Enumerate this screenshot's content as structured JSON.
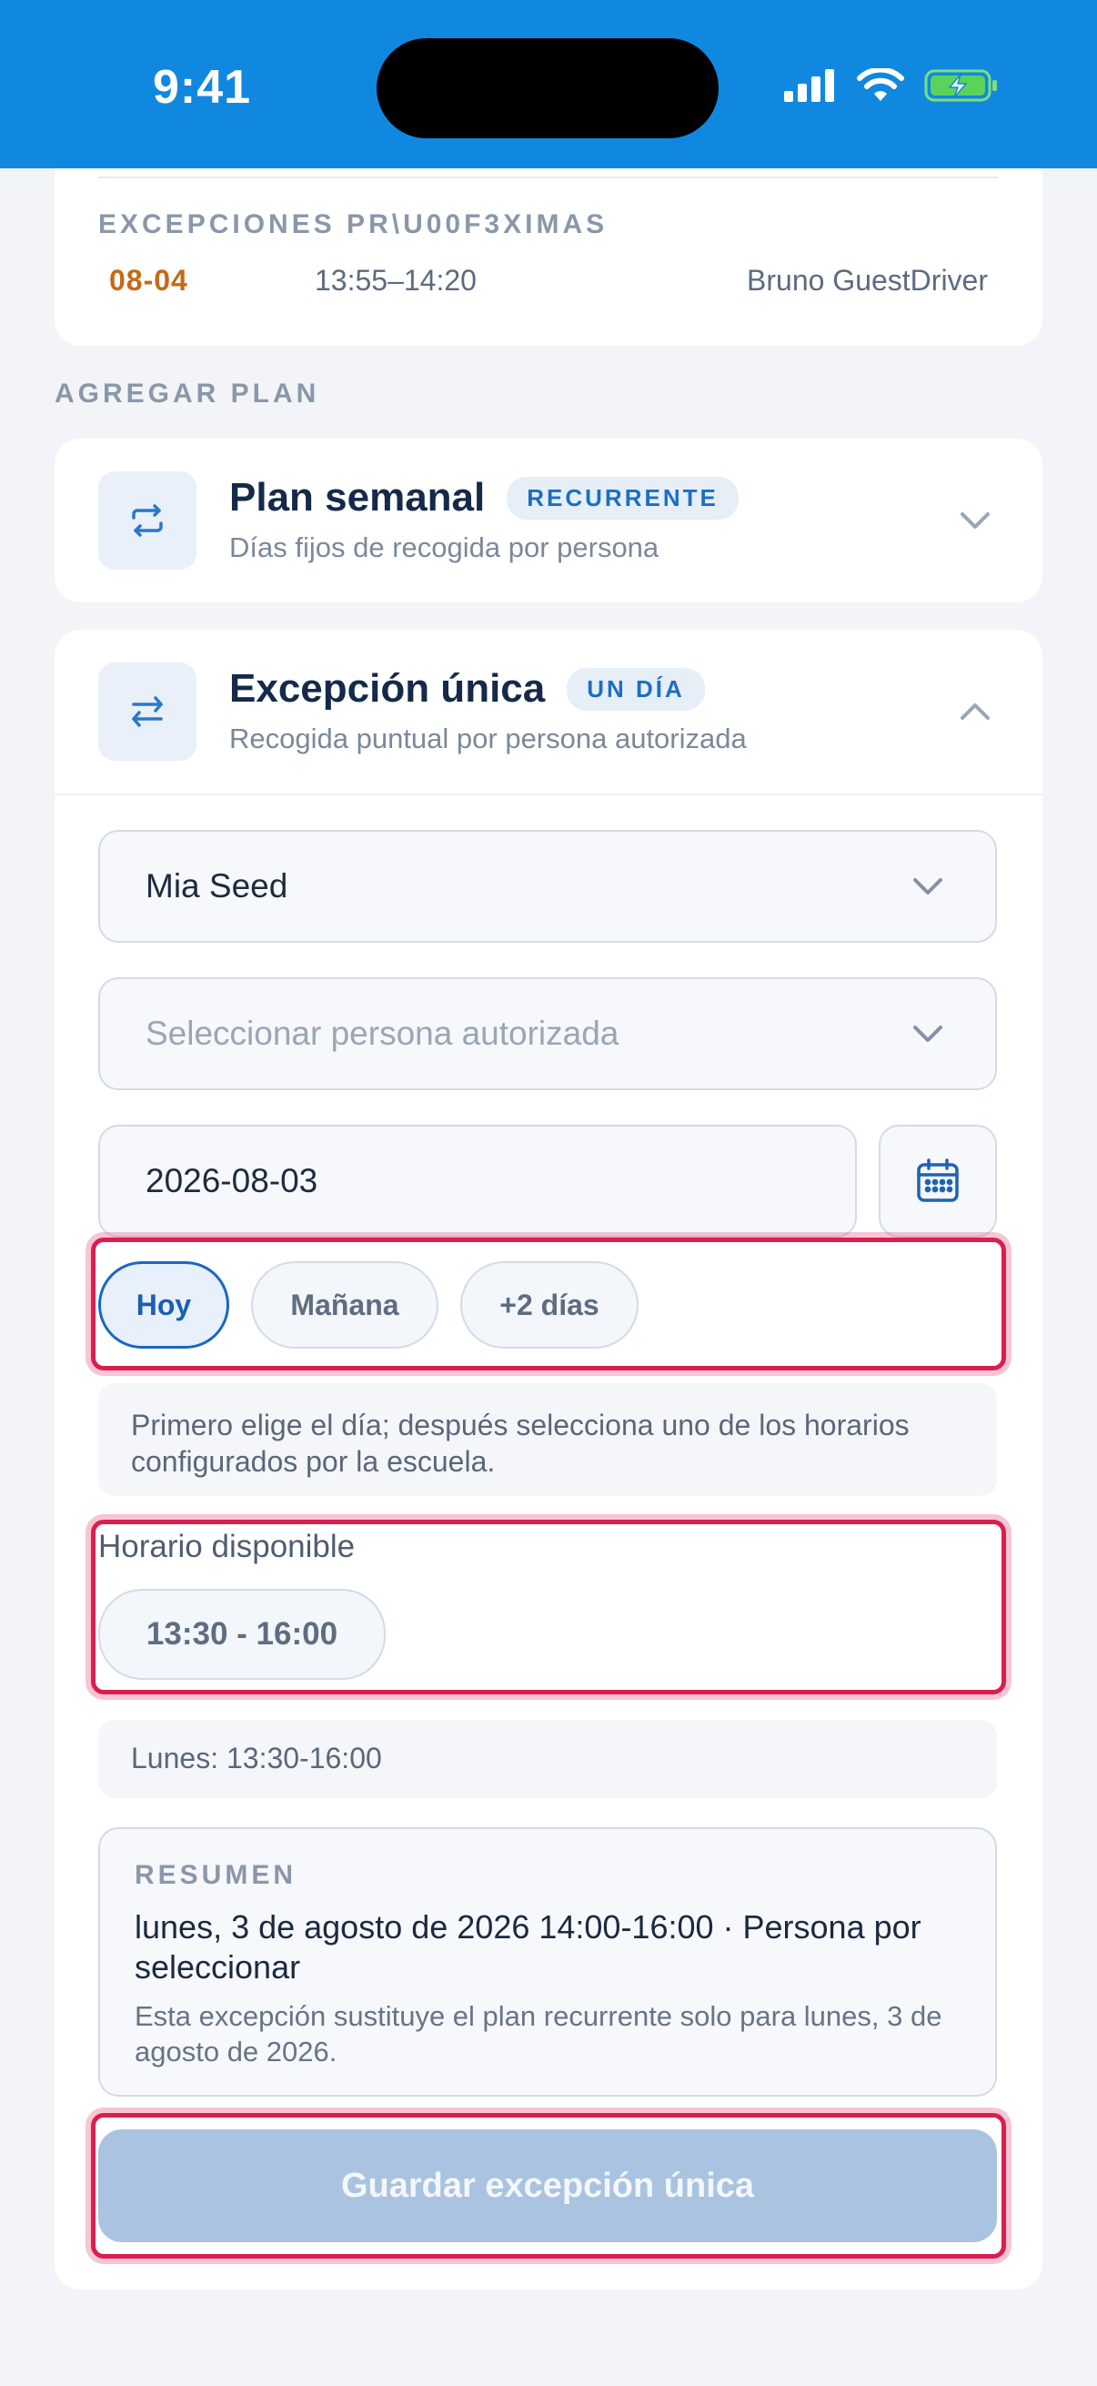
{
  "status_bar": {
    "time": "9:41"
  },
  "upcoming_exceptions": {
    "title": "EXCEPCIONES PR\\U00F3XIMAS",
    "items": [
      {
        "date": "08-04",
        "time": "13:55–14:20",
        "person": "Bruno GuestDriver"
      }
    ]
  },
  "add_plan": {
    "label": "AGREGAR PLAN",
    "weekly": {
      "title": "Plan semanal",
      "badge": "RECURRENTE",
      "subtitle": "Días fijos de recogida por persona"
    },
    "single": {
      "title": "Excepción única",
      "badge": "UN DÍA",
      "subtitle": "Recogida puntual por persona autorizada",
      "student_value": "Mia Seed",
      "authorized_placeholder": "Seleccionar persona autorizada",
      "date_value": "2026-08-03",
      "quick_days": [
        "Hoy",
        "Mañana",
        "+2 días"
      ],
      "day_hint": "Primero elige el día; después selecciona uno de los horarios configurados por la escuela.",
      "schedule_label": "Horario disponible",
      "schedule_option": "13:30 - 16:00",
      "schedule_info": "Lunes: 13:30-16:00",
      "summary_label": "RESUMEN",
      "summary_main": "lunes, 3 de agosto de 2026 14:00-16:00 · Persona por seleccionar",
      "summary_note": "Esta excepción sustituye el plan recurrente solo para lunes, 3 de agosto de 2026.",
      "save_label": "Guardar excepción única"
    }
  },
  "colors": {
    "header": "#1188e0",
    "accent": "#1b6fc2",
    "date_orange": "#c46a17",
    "highlight": "#d81f4f",
    "disabled_button": "#a9c3e0"
  }
}
